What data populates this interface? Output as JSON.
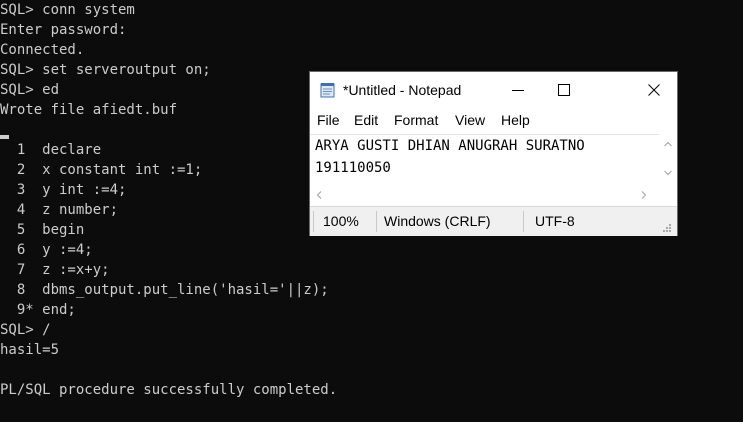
{
  "terminal": {
    "lines_top": [
      "SQL> conn system",
      "Enter password:",
      "Connected.",
      "SQL> set serveroutput on;",
      "SQL> ed",
      "Wrote file afiedt.buf"
    ],
    "lines_bottom": [
      "  1  declare",
      "  2  x constant int :=1;",
      "  3  y int :=4;",
      "  4  z number;",
      "  5  begin",
      "  6  y :=4;",
      "  7  z :=x+y;",
      "  8  dbms_output.put_line('hasil='||z);",
      "  9* end;",
      "SQL> /",
      "hasil=5",
      "",
      "PL/SQL procedure successfully completed."
    ]
  },
  "notepad": {
    "title": "*Untitled - Notepad",
    "menu": [
      "File",
      "Edit",
      "Format",
      "View",
      "Help"
    ],
    "content_lines": [
      "ARYA GUSTI DHIAN ANUGRAH SURATNO",
      "191110050"
    ],
    "status": {
      "zoom": "100%",
      "line_ending": "Windows (CRLF)",
      "encoding": "UTF-8"
    }
  },
  "icons": {
    "app": "notepad-icon",
    "minimize": "minimize-icon",
    "maximize": "maximize-icon",
    "close": "close-icon"
  },
  "colors": {
    "terminal_bg": "#0c0c0c",
    "terminal_fg": "#cccccc",
    "window_bg": "#ffffff",
    "statusbar_bg": "#f0f0f0"
  }
}
